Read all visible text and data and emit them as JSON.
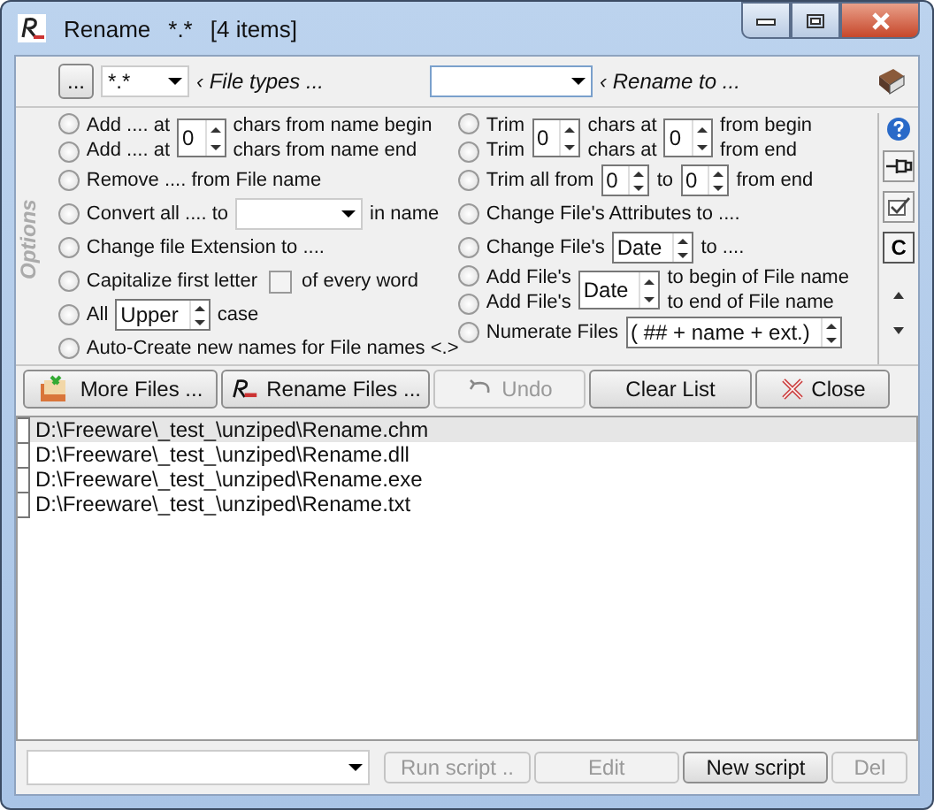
{
  "window": {
    "title": "Rename",
    "filter": "*.*",
    "count": "[4 items]"
  },
  "toolbar": {
    "browse": "...",
    "file_types": {
      "value": "*.*",
      "label": "‹ File types ..."
    },
    "rename_to": {
      "value_label": "‹ Rename to ..."
    }
  },
  "options_label": "Options",
  "options_left": [
    {
      "kind": "pair",
      "radios": [
        {
          "selected": false
        },
        {
          "selected": false
        }
      ],
      "cells": [
        {
          "kind": "text",
          "lines": [
            "Add .... at",
            "Add .... at"
          ]
        },
        {
          "kind": "spin",
          "value": "0"
        },
        {
          "kind": "text",
          "lines": [
            "chars from name begin",
            "chars from name end"
          ]
        }
      ]
    },
    {
      "kind": "single",
      "selected": false,
      "cells": [
        {
          "kind": "text",
          "text": "Remove .... from File name"
        }
      ]
    },
    {
      "kind": "single",
      "selected": false,
      "cells": [
        {
          "kind": "text",
          "text": "Convert all .... to"
        },
        {
          "kind": "combo"
        },
        {
          "kind": "text",
          "text": "in name"
        }
      ]
    },
    {
      "kind": "single",
      "selected": false,
      "cells": [
        {
          "kind": "text",
          "text": "Change file Extension to ...."
        }
      ]
    },
    {
      "kind": "single",
      "selected": false,
      "cells": [
        {
          "kind": "text",
          "text": "Capitalize first letter"
        },
        {
          "kind": "check",
          "checked": false
        },
        {
          "kind": "text",
          "text": "of every word"
        }
      ]
    },
    {
      "kind": "single",
      "selected": false,
      "cells": [
        {
          "kind": "text",
          "text": "All"
        },
        {
          "kind": "spin",
          "value": "Upper"
        },
        {
          "kind": "text",
          "text": "case"
        }
      ]
    },
    {
      "kind": "single",
      "selected": false,
      "cells": [
        {
          "kind": "text",
          "text": "Auto-Create new names for File names <.>"
        }
      ]
    }
  ],
  "options_right": [
    {
      "kind": "pair",
      "radios": [
        {
          "selected": false
        },
        {
          "selected": false
        }
      ],
      "cells": [
        {
          "kind": "text",
          "lines": [
            "Trim",
            "Trim"
          ]
        },
        {
          "kind": "spin",
          "value": "0"
        },
        {
          "kind": "text",
          "lines": [
            "chars at",
            "chars at"
          ]
        },
        {
          "kind": "spin",
          "value": "0"
        },
        {
          "kind": "text",
          "lines": [
            "from begin",
            "from  end"
          ]
        }
      ]
    },
    {
      "kind": "single",
      "selected": false,
      "cells": [
        {
          "kind": "text",
          "text": "Trim all from"
        },
        {
          "kind": "spin",
          "value": "0"
        },
        {
          "kind": "text",
          "text": "to"
        },
        {
          "kind": "spin",
          "value": "0"
        },
        {
          "kind": "text",
          "text": "from end"
        }
      ]
    },
    {
      "kind": "single",
      "selected": false,
      "cells": [
        {
          "kind": "text",
          "text": "Change File's Attributes to ...."
        }
      ]
    },
    {
      "kind": "single",
      "selected": false,
      "cells": [
        {
          "kind": "text",
          "text": "Change File's"
        },
        {
          "kind": "spin",
          "value": "Date"
        },
        {
          "kind": "text",
          "text": "to ...."
        }
      ]
    },
    {
      "kind": "pair",
      "radios": [
        {
          "selected": false
        },
        {
          "selected": false
        }
      ],
      "cells": [
        {
          "kind": "text",
          "lines": [
            "Add File's",
            "Add File's"
          ]
        },
        {
          "kind": "spin",
          "value": "Date"
        },
        {
          "kind": "text",
          "lines": [
            "to begin of File name",
            "to end of File name"
          ]
        }
      ]
    },
    {
      "kind": "single",
      "selected": false,
      "cells": [
        {
          "kind": "text",
          "text": "Numerate Files"
        },
        {
          "kind": "spin",
          "value": "( ## + name + ext.)"
        }
      ]
    }
  ],
  "side_tools": [
    {
      "kind": "help"
    },
    {
      "kind": "pin"
    },
    {
      "kind": "checklist"
    },
    {
      "kind": "text",
      "text": "C"
    }
  ],
  "buttons": [
    {
      "label": "More Files ...",
      "kind": "files",
      "disabled": false
    },
    {
      "label": "Rename Files ...",
      "kind": "rename",
      "disabled": false
    },
    {
      "label": "Undo",
      "kind": "undo",
      "disabled": true
    },
    {
      "label": "Clear List",
      "kind": "plain",
      "disabled": false
    },
    {
      "label": "Close",
      "kind": "close",
      "disabled": false
    }
  ],
  "files": [
    {
      "path": "D:\\Freeware\\_test_\\unziped\\Rename.chm",
      "selected": true
    },
    {
      "path": "D:\\Freeware\\_test_\\unziped\\Rename.dll",
      "selected": false
    },
    {
      "path": "D:\\Freeware\\_test_\\unziped\\Rename.exe",
      "selected": false
    },
    {
      "path": "D:\\Freeware\\_test_\\unziped\\Rename.txt",
      "selected": false
    }
  ],
  "scripts": [
    {
      "label": "Run script ..",
      "disabled": true
    },
    {
      "label": "Edit",
      "disabled": true
    },
    {
      "label": "New script",
      "disabled": false
    },
    {
      "label": "Del",
      "disabled": true
    }
  ]
}
